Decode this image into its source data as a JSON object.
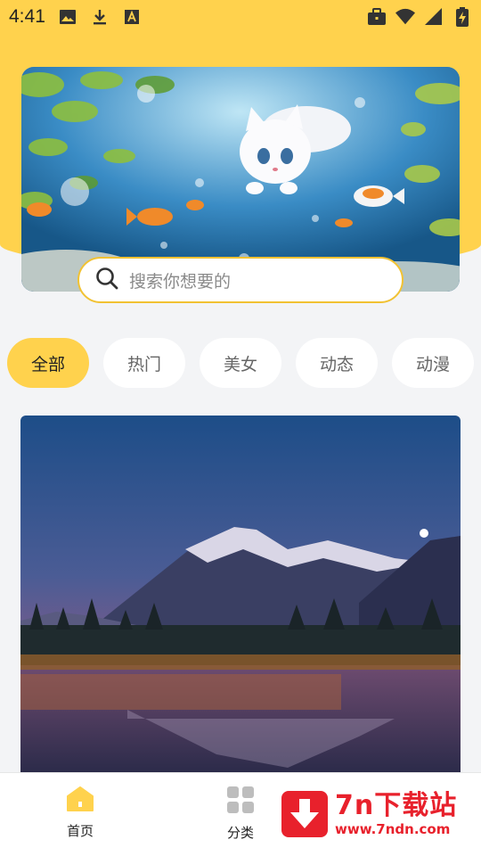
{
  "status_bar": {
    "time": "4:41",
    "left_icons": [
      "image-icon",
      "download-icon",
      "font-icon"
    ],
    "right_icons": [
      "briefcase-icon",
      "wifi-icon",
      "signal-icon",
      "battery-charging-icon"
    ]
  },
  "search": {
    "placeholder": "搜索你想要的"
  },
  "tabs": [
    {
      "label": "全部",
      "active": true
    },
    {
      "label": "热门",
      "active": false
    },
    {
      "label": "美女",
      "active": false
    },
    {
      "label": "动态",
      "active": false
    },
    {
      "label": "动漫",
      "active": false
    }
  ],
  "bottom_nav": {
    "home_label": "首页",
    "category_label": "分类"
  },
  "watermark": {
    "title": "7n下载站",
    "url": "www.7ndn.com"
  },
  "colors": {
    "accent": "#ffd24d",
    "search_border": "#f1c233",
    "watermark": "#e8212c"
  }
}
